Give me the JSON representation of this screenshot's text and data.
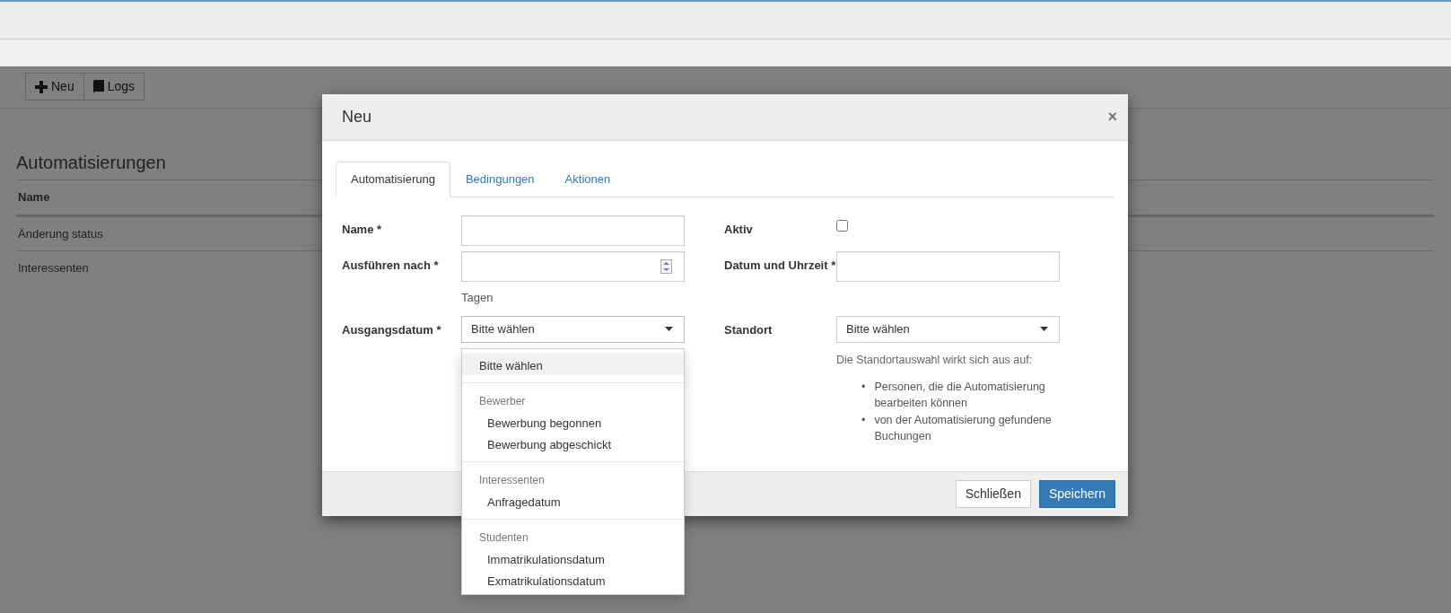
{
  "toolbar": {
    "buttons": [
      {
        "kind": "plus",
        "label": "Neu"
      },
      {
        "kind": "book",
        "label": "Logs"
      }
    ]
  },
  "panel": {
    "title": "Automatisierungen",
    "table": {
      "columns": [
        "Name"
      ],
      "rows": [
        [
          "Änderung status"
        ],
        [
          "Interessenten"
        ]
      ]
    }
  },
  "modal": {
    "title": "Neu",
    "close": "×",
    "tabs": [
      {
        "label": "Automatisierung",
        "selected": true
      },
      {
        "label": "Bedingungen",
        "selected": false
      },
      {
        "label": "Aktionen",
        "selected": false
      }
    ],
    "rows": [
      [
        {
          "kind": "text",
          "label": "Name *"
        },
        {
          "kind": "checkbox",
          "label": "Aktiv",
          "checked": false
        }
      ],
      [
        {
          "kind": "number",
          "label": "Ausführen nach *",
          "suffix": "Tagen"
        },
        {
          "kind": "text",
          "label": "Datum und Uhrzeit *"
        }
      ],
      [
        {
          "kind": "select",
          "label": "Ausgangsdatum *",
          "value": "Bitte wählen",
          "expanded": true,
          "options": [
            {
              "kind": "option",
              "label": "Bitte wählen",
              "selected": true
            },
            {
              "kind": "group",
              "label": "Bewerber",
              "options": [
                {
                  "label": "Bewerbung begonnen",
                  "selected": false
                },
                {
                  "label": "Bewerbung abgeschickt",
                  "selected": false
                }
              ]
            },
            {
              "kind": "group",
              "label": "Interessenten",
              "options": [
                {
                  "label": "Anfragedatum",
                  "selected": false
                }
              ]
            },
            {
              "kind": "group",
              "label": "Studenten",
              "options": [
                {
                  "label": "Immatrikulationsdatum",
                  "selected": false
                },
                {
                  "label": "Exmatrikulationsdatum",
                  "selected": false
                }
              ]
            }
          ]
        },
        {
          "kind": "select",
          "label": "Standort",
          "value": "Bitte wählen",
          "expanded": false,
          "help": "Die Standortauswahl wirkt sich aus auf:",
          "bullets": [
            {
              "marker": "•",
              "text": "Personen, die die Automatisierung bearbeiten können"
            },
            {
              "marker": "•",
              "text": "von der Automatisierung gefundene Buchungen"
            }
          ]
        }
      ]
    ],
    "buttons": [
      {
        "kind": "secondary",
        "label": "Schließen"
      },
      {
        "kind": "primary",
        "label": "Speichern"
      }
    ]
  }
}
